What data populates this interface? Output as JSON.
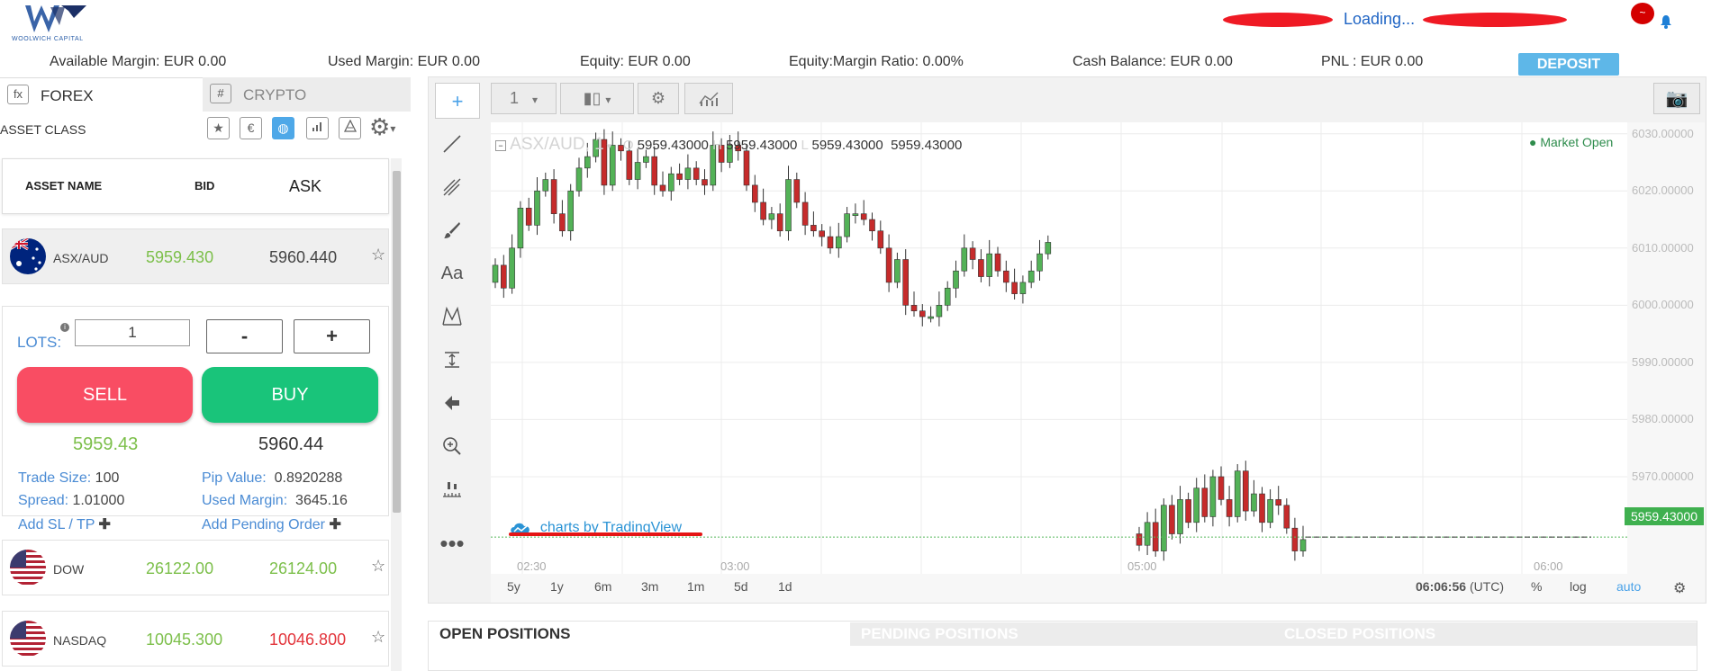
{
  "header": {
    "brand": "WOOLWICH CAPITAL",
    "loading_text": "Loading...",
    "notification_count": "~"
  },
  "metrics": {
    "available_margin": "Available Margin: EUR 0.00",
    "used_margin": "Used Margin: EUR  0.00",
    "equity": "Equity: EUR  0.00",
    "equity_margin_ratio": "Equity:Margin Ratio: 0.00%",
    "cash_balance": "Cash Balance: EUR 0.00",
    "pnl": "PNL : EUR  0.00",
    "deposit_label": "DEPOSIT"
  },
  "tabs": {
    "forex_icon": "fx",
    "forex": "FOREX",
    "crypto_icon": "#",
    "crypto": "CRYPTO"
  },
  "asset_class_label": "ASSET CLASS",
  "asset_filters": [
    "star-icon",
    "euro-icon",
    "globe-icon",
    "bar-chart-icon",
    "pyramid-icon"
  ],
  "table_headers": {
    "asset_name": "ASSET NAME",
    "bid": "BID",
    "ask": "ASK"
  },
  "assets": [
    {
      "name": "ASX/AUD",
      "bid": "5959.430",
      "ask": "5960.440",
      "ask_color": "neutral",
      "flag": "australia"
    },
    {
      "name": "DOW",
      "bid": "26122.00",
      "ask": "26124.00",
      "ask_color": "neutral",
      "flag": "usa"
    },
    {
      "name": "NASDAQ",
      "bid": "10045.300",
      "ask": "10046.800",
      "ask_color": "red",
      "flag": "usa"
    }
  ],
  "trade_panel": {
    "lots_label": "LOTS:",
    "lots_value": "1",
    "minus": "-",
    "plus": "+",
    "sell_label": "SELL",
    "buy_label": "BUY",
    "sell_price": "5959.43",
    "buy_price": "5960.44",
    "trade_size_label": "Trade Size:",
    "trade_size": "100",
    "spread_label": "Spread:",
    "spread": "1.01000",
    "pip_value_label": "Pip Value:",
    "pip_value": "0.8920288",
    "used_margin_label": "Used Margin:",
    "used_margin": "3645.16",
    "add_sl_tp": "Add SL / TP",
    "add_pending": "Add Pending Order"
  },
  "chart_toolbar": {
    "interval": "1"
  },
  "chart_data": {
    "type": "candlestick",
    "symbol": "ASX/AUD, 1",
    "ohlc_readout": {
      "o": "5959.43000",
      "h": "5959.43000",
      "l": "5959.43000",
      "c": "5959.43000"
    },
    "o_prefix": "O",
    "h_prefix": "H",
    "l_prefix": "L",
    "market_status": "Market Open",
    "y_ticks": [
      "6030.00000",
      "6020.00000",
      "6010.00000",
      "6000.00000",
      "5990.00000",
      "5980.00000",
      "5970.00000"
    ],
    "ylim": [
      5953,
      6032
    ],
    "x_ticks": [
      "02:30",
      "03:00",
      "05:00",
      "06:00"
    ],
    "last_price": "5959.43000",
    "segment1_closes": [
      6007,
      6003,
      6010,
      6017,
      6014,
      6020,
      6022,
      6016,
      6013,
      6020,
      6024,
      6026,
      6029,
      6021,
      6028,
      6027,
      6022,
      6025,
      6026,
      6021,
      6020,
      6023,
      6022,
      6024,
      6022,
      6021,
      6028,
      6025,
      6028,
      6027,
      6021,
      6018,
      6015,
      6016,
      6013,
      6022,
      6018,
      6014,
      6013,
      6012,
      6010,
      6012,
      6016,
      6016,
      6015,
      6013,
      6010,
      6004,
      6008,
      6000,
      5999,
      5998,
      5998,
      6000,
      6003,
      6006,
      6010,
      6008,
      6005,
      6009,
      6006,
      6004,
      6002,
      6004,
      6006,
      6009,
      6011
    ],
    "segment2_closes": [
      5958,
      5962,
      5957,
      5965,
      5960,
      5966,
      5962,
      5968,
      5963,
      5970,
      5966,
      5963,
      5971,
      5964,
      5967,
      5962,
      5966,
      5965,
      5961,
      5957,
      5959
    ]
  },
  "tradingview_credit": "charts by TradingView",
  "ranges": [
    "5y",
    "1y",
    "6m",
    "3m",
    "1m",
    "5d",
    "1d"
  ],
  "chart_footer": {
    "clock": "06:06:56",
    "tz": "(UTC)",
    "pct": "%",
    "log": "log",
    "auto": "auto"
  },
  "positions_tabs": {
    "open": "OPEN POSITIONS",
    "pending": "PENDING POSITIONS",
    "closed": "CLOSED POSITIONS"
  },
  "colors": {
    "up_candle": "#53b257",
    "down_candle": "#c62b2b",
    "sell": "#f94d63",
    "buy": "#19c47a",
    "deposit": "#5eb7e8"
  }
}
